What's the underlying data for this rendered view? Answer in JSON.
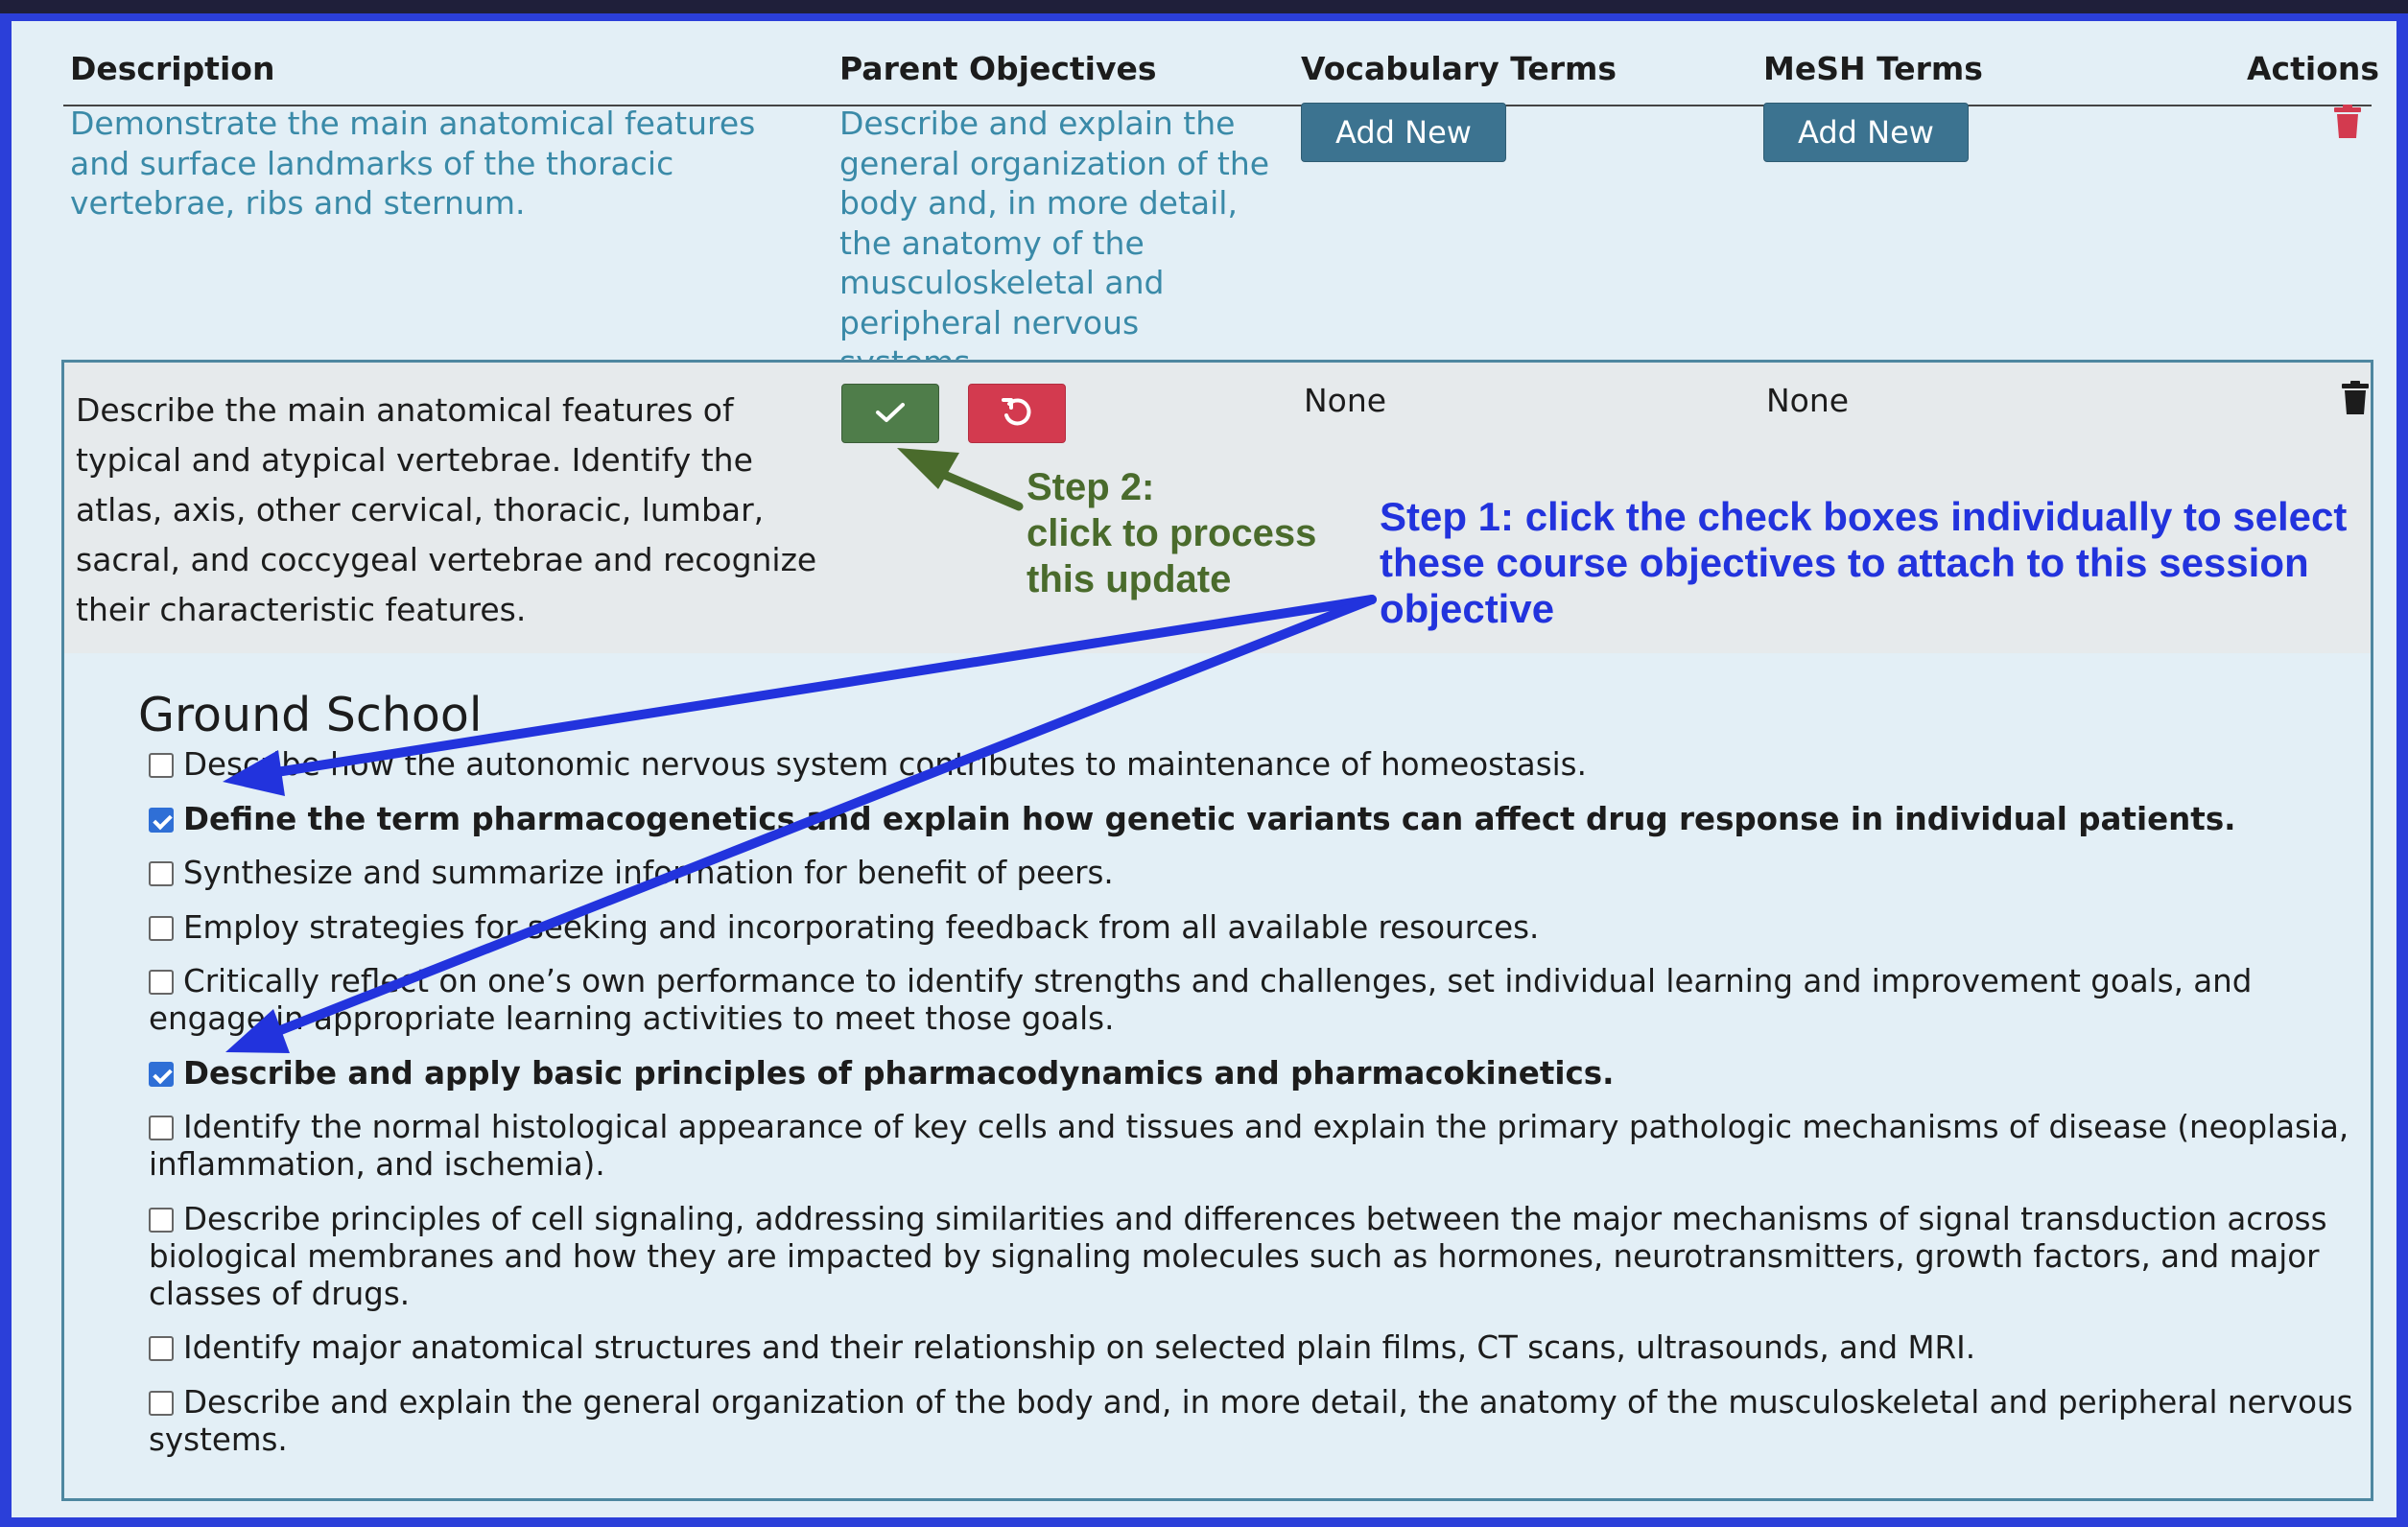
{
  "table": {
    "headers": {
      "description": "Description",
      "parent_objectives": "Parent Objectives",
      "vocabulary_terms": "Vocabulary Terms",
      "mesh_terms": "MeSH Terms",
      "actions": "Actions"
    },
    "row1": {
      "description": "Demonstrate the main anatomical features and surface landmarks of the thoracic vertebrae, ribs and sternum.",
      "parent_objective": "Describe and explain the general organization of the body and, in more detail, the anatomy of the musculoskeletal and peripheral nervous systems.",
      "vocab_button": "Add New",
      "mesh_button": "Add New"
    },
    "row2": {
      "description": "Describe the main anatomical features of typical and atypical vertebrae. Identify the atlas, axis, other cervical, thoracic, lumbar, sacral, and coccygeal vertebrae and recognize their characteristic features.",
      "vocab_value": "None",
      "mesh_value": "None"
    }
  },
  "objectives_group": {
    "title": "Ground School",
    "items": [
      {
        "label": "Describe how the autonomic nervous system contributes to maintenance of homeostasis.",
        "checked": false
      },
      {
        "label": "Define the term pharmacogenetics and explain how genetic variants can affect drug response in individual patients.",
        "checked": true
      },
      {
        "label": "Synthesize and summarize information for benefit of peers.",
        "checked": false
      },
      {
        "label": "Employ strategies for seeking and incorporating feedback from all available resources.",
        "checked": false
      },
      {
        "label": "Critically reflect on one’s own performance to identify strengths and challenges, set individual learning and improvement goals, and engage in appropriate learning activities to meet those goals.",
        "checked": false
      },
      {
        "label": "Describe and apply basic principles of pharmacodynamics and pharmacokinetics.",
        "checked": true
      },
      {
        "label": "Identify the normal histological appearance of key cells and tissues and explain the primary pathologic mechanisms of disease (neoplasia, inflammation, and ischemia).",
        "checked": false
      },
      {
        "label": "Describe principles of cell signaling, addressing similarities and differences between the major mechanisms of signal transduction across biological membranes and how they are impacted by signaling molecules such as hormones, neurotransmitters, growth factors, and major classes of drugs.",
        "checked": false
      },
      {
        "label": "Identify major anatomical structures and their relationship on selected plain films, CT scans, ultrasounds, and MRI.",
        "checked": false
      },
      {
        "label": "Describe and explain the general organization of the body and, in more detail, the anatomy of the musculoskeletal and peripheral nervous systems.",
        "checked": false
      }
    ]
  },
  "annotations": {
    "step2": "Step 2:\nclick to process\nthis update",
    "step1": "Step 1: click the check boxes individually to select these course objectives to attach to this session objective"
  },
  "icons": {
    "save": "check-icon",
    "revert": "undo-icon",
    "delete": "trash-icon"
  },
  "colors": {
    "teal_link": "#3a8aa8",
    "add_button": "#3c7390",
    "save_button": "#4f7d4a",
    "revert_button": "#d33a4f",
    "delete_red": "#d33a4f",
    "annotation_blue": "#2233dd",
    "annotation_green": "#4a6b2c",
    "frame_blue": "#2b3fd9"
  }
}
